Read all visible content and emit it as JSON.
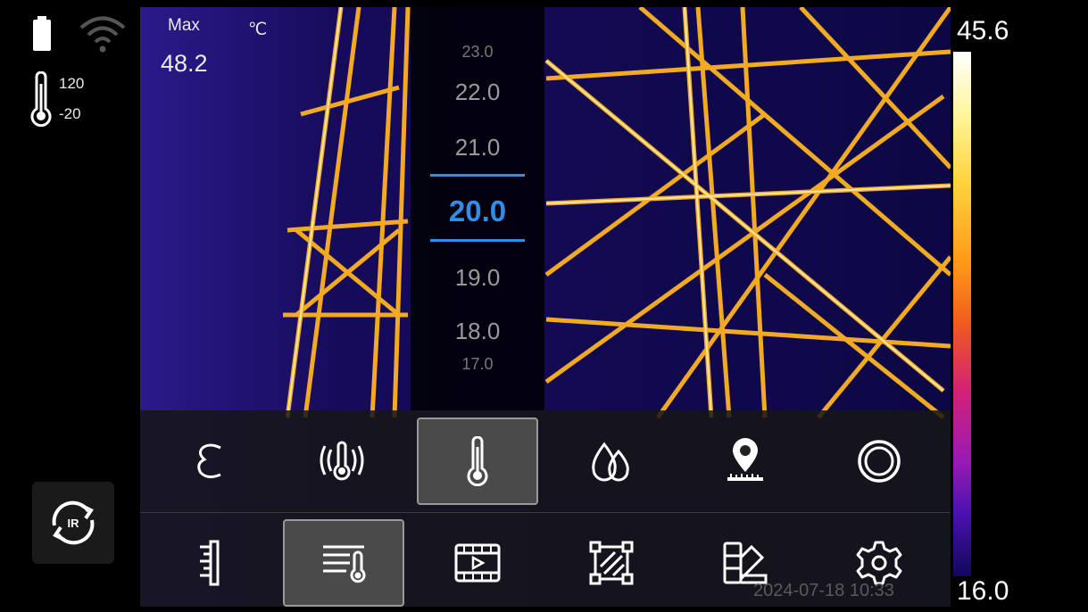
{
  "status": {
    "battery_icon": "battery-icon",
    "wifi_icon": "wifi-icon",
    "range_icon": "thermometer-range-icon",
    "range_high": "120",
    "range_low": "-20"
  },
  "readout": {
    "max_label": "Max",
    "max_value": "48.2",
    "unit": "℃"
  },
  "picker": {
    "values": [
      "23.0",
      "22.0",
      "21.0",
      "20.0",
      "19.0",
      "18.0",
      "17.0"
    ],
    "selected": "20.0",
    "selected_color": "#2f8fe8"
  },
  "toolbar": {
    "row1": [
      {
        "icon": "emissivity-icon",
        "active": false
      },
      {
        "icon": "temperature-alarm-icon",
        "active": false
      },
      {
        "icon": "thermometer-icon",
        "active": true
      },
      {
        "icon": "humidity-icon",
        "active": false
      },
      {
        "icon": "distance-location-icon",
        "active": false
      },
      {
        "icon": "reflective-temperature-icon",
        "active": false
      }
    ],
    "row2": [
      {
        "icon": "ruler-icon",
        "active": false
      },
      {
        "icon": "temperature-list-icon",
        "active": true
      },
      {
        "icon": "video-icon",
        "active": false
      },
      {
        "icon": "region-measure-icon",
        "active": false
      },
      {
        "icon": "palette-icon",
        "active": false
      },
      {
        "icon": "settings-icon",
        "active": false
      }
    ]
  },
  "ir_button": {
    "icon": "ir-switch-icon",
    "label": "IR"
  },
  "timestamp": "2024-07-18 10:33",
  "scale": {
    "max": "45.6",
    "min": "16.0",
    "colors": [
      "#ffffff",
      "#ffd23c",
      "#f05a1e",
      "#9a1ab4",
      "#12085a"
    ]
  }
}
